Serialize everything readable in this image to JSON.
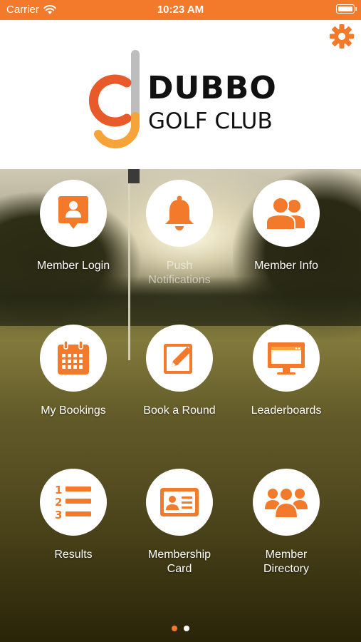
{
  "status_bar": {
    "carrier": "Carrier",
    "time": "10:23 AM",
    "battery_level": 1.0
  },
  "header": {
    "settings_icon": "gear-icon",
    "logo": {
      "line1": "DUBBO",
      "line2": "GOLF CLUB"
    }
  },
  "colors": {
    "accent": "#f37a2a",
    "logo_gray": "#bdbdbd",
    "text_dark": "#111111"
  },
  "tiles": [
    {
      "label": "Member Login",
      "icon": "member-login-icon"
    },
    {
      "label": "Push Notifications",
      "icon": "bell-icon"
    },
    {
      "label": "Member Info",
      "icon": "users-icon"
    },
    {
      "label": "My Bookings",
      "icon": "calendar-icon"
    },
    {
      "label": "Book a Round",
      "icon": "pencil-icon"
    },
    {
      "label": "Leaderboards",
      "icon": "monitor-icon"
    },
    {
      "label": "Results",
      "icon": "numbered-list-icon"
    },
    {
      "label": "Membership Card",
      "icon": "id-card-icon"
    },
    {
      "label": "Member Directory",
      "icon": "group-icon"
    }
  ],
  "pager": {
    "total_pages": 2,
    "current_page": 1
  }
}
